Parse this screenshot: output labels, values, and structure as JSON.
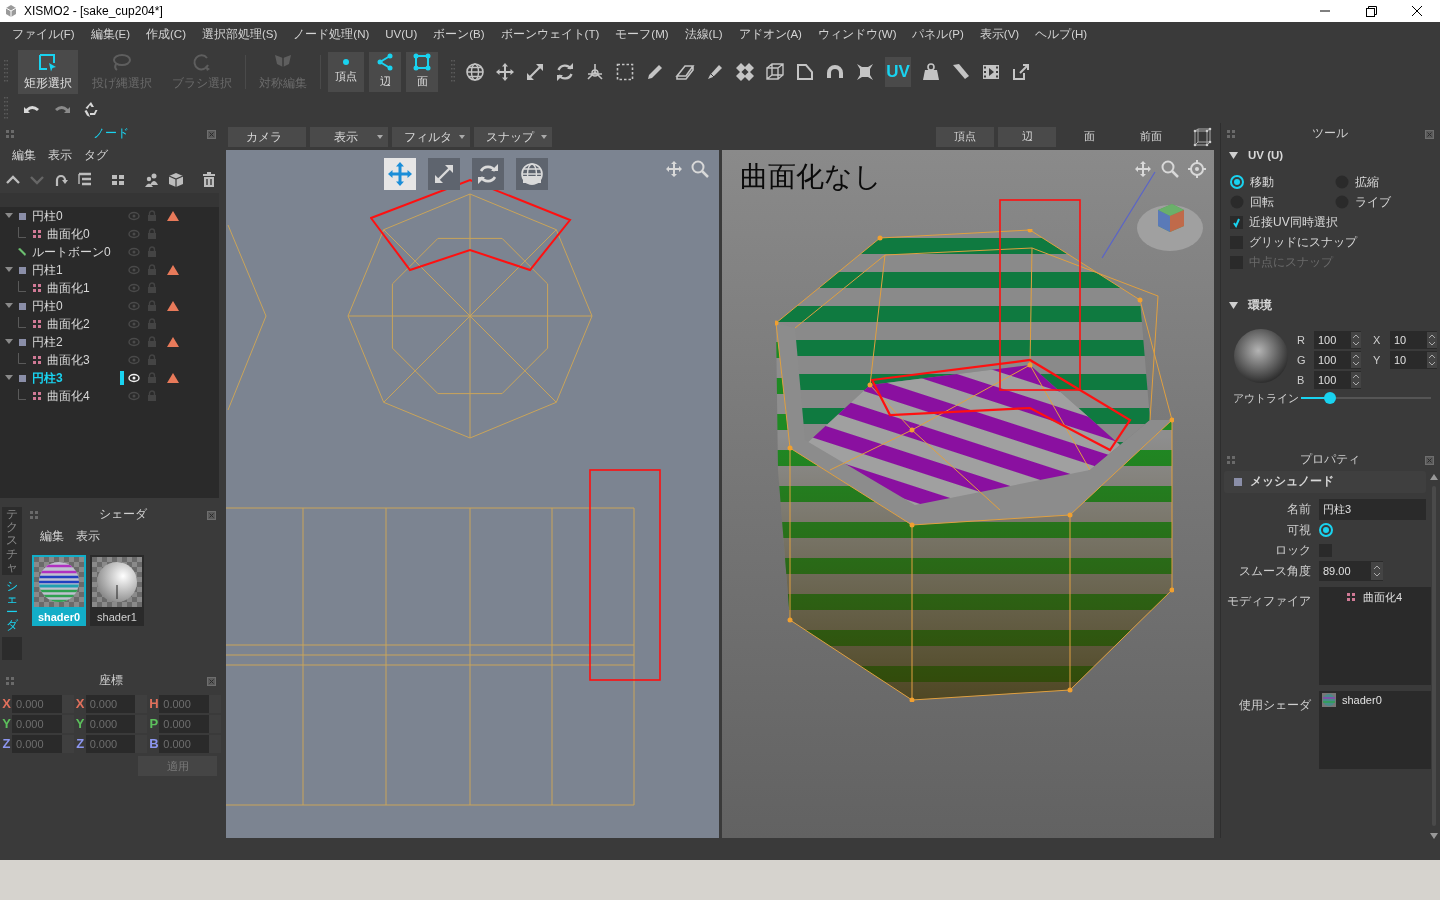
{
  "window": {
    "title": "XISMO2 - [sake_cup204*]"
  },
  "menu": [
    "ファイル(F)",
    "編集(E)",
    "作成(C)",
    "選択部処理(S)",
    "ノード処理(N)",
    "UV(U)",
    "ボーン(B)",
    "ボーンウェイト(T)",
    "モーフ(M)",
    "法線(L)",
    "アドオン(A)",
    "ウィンドウ(W)",
    "パネル(P)",
    "表示(V)",
    "ヘルプ(H)"
  ],
  "toolbar": {
    "select_tools": [
      {
        "label": "矩形選択",
        "selected": true,
        "disabled": false
      },
      {
        "label": "投げ縄選択",
        "selected": false,
        "disabled": true
      },
      {
        "label": "ブラシ選択",
        "selected": false,
        "disabled": true
      },
      {
        "label": "対称編集",
        "selected": false,
        "disabled": true
      }
    ],
    "modes": [
      {
        "label": "頂点",
        "selected": true
      },
      {
        "label": "辺",
        "selected": true
      },
      {
        "label": "面",
        "selected": true
      }
    ],
    "uv_button": {
      "label": "UV",
      "selected": true
    }
  },
  "node_panel": {
    "title": "ノード",
    "active": true,
    "menu": [
      "編集",
      "表示",
      "タグ"
    ],
    "tree": [
      {
        "label": "円柱0",
        "kind": "mesh",
        "expanded": true,
        "selected": false,
        "warning": true,
        "children": [
          {
            "label": "曲面化0",
            "kind": "modifier",
            "selected": false
          }
        ]
      },
      {
        "label": "ルートボーン0",
        "kind": "bone",
        "selected": false
      },
      {
        "label": "円柱1",
        "kind": "mesh",
        "expanded": true,
        "selected": false,
        "warning": true,
        "children": [
          {
            "label": "曲面化1",
            "kind": "modifier",
            "selected": false
          }
        ]
      },
      {
        "label": "円柱0",
        "kind": "mesh",
        "expanded": true,
        "selected": false,
        "warning": true,
        "children": [
          {
            "label": "曲面化2",
            "kind": "modifier",
            "selected": false
          }
        ]
      },
      {
        "label": "円柱2",
        "kind": "mesh",
        "expanded": true,
        "selected": false,
        "warning": true,
        "children": [
          {
            "label": "曲面化3",
            "kind": "modifier",
            "selected": false
          }
        ]
      },
      {
        "label": "円柱3",
        "kind": "mesh",
        "expanded": true,
        "selected": true,
        "warning": true,
        "children": [
          {
            "label": "曲面化4",
            "kind": "modifier",
            "selected": false
          }
        ]
      }
    ]
  },
  "shader_panel": {
    "title": "シェーダ",
    "active": false,
    "side_tabs": [
      {
        "label": "テクスチャ",
        "selected": false
      },
      {
        "label": "シェーダ",
        "selected": true
      }
    ],
    "menu": [
      "編集",
      "表示"
    ],
    "shaders": [
      {
        "name": "shader0",
        "kind": "striped",
        "selected": true
      },
      {
        "name": "shader1",
        "kind": "white",
        "selected": false
      }
    ]
  },
  "coords_panel": {
    "title": "座標",
    "active": false,
    "fields": [
      {
        "label": "X",
        "value": "0.000",
        "color": "#e0705c"
      },
      {
        "label": "X",
        "value": "0.000",
        "color": "#e0705c"
      },
      {
        "label": "H",
        "value": "0.000",
        "color": "#e0705c"
      },
      {
        "label": "Y",
        "value": "0.000",
        "color": "#5cc05c"
      },
      {
        "label": "Y",
        "value": "0.000",
        "color": "#5cc05c"
      },
      {
        "label": "P",
        "value": "0.000",
        "color": "#5cc05c"
      },
      {
        "label": "Z",
        "value": "0.000",
        "color": "#8c96f0"
      },
      {
        "label": "Z",
        "value": "0.000",
        "color": "#8c96f0"
      },
      {
        "label": "B",
        "value": "0.000",
        "color": "#8c96f0"
      }
    ],
    "apply_button": {
      "label": "適用",
      "disabled": true
    }
  },
  "viewport_bar": {
    "left": [
      {
        "label": "カメラ",
        "dropdown": false
      },
      {
        "label": "表示",
        "dropdown": true
      },
      {
        "label": "フィルタ",
        "dropdown": true
      },
      {
        "label": "スナップ",
        "dropdown": true
      }
    ],
    "right": [
      {
        "label": "頂点",
        "selected": true
      },
      {
        "label": "辺",
        "selected": true
      },
      {
        "label": "面",
        "selected": false
      },
      {
        "label": "前面",
        "selected": false
      }
    ]
  },
  "uv_view": {
    "tools": [
      {
        "kind": "move",
        "selected": true
      },
      {
        "kind": "scale",
        "selected": false
      },
      {
        "kind": "rotate",
        "selected": false
      },
      {
        "kind": "live",
        "selected": false
      }
    ]
  },
  "model_view": {
    "label": "曲面化なし"
  },
  "tool_panel": {
    "title": "ツール",
    "active": false,
    "uv_section": {
      "title": "UV (U)",
      "expanded": true,
      "radios": [
        {
          "label": "移動",
          "selected": true
        },
        {
          "label": "拡縮",
          "selected": false
        },
        {
          "label": "回転",
          "selected": false
        },
        {
          "label": "ライブ",
          "selected": false
        }
      ],
      "checkboxes": [
        {
          "label": "近接UV同時選択",
          "checked": true,
          "disabled": false
        },
        {
          "label": "グリッドにスナップ",
          "checked": false,
          "disabled": false
        },
        {
          "label": "中点にスナップ",
          "checked": false,
          "disabled": true
        }
      ]
    },
    "env_section": {
      "title": "環境",
      "expanded": true,
      "fields": [
        {
          "label": "R",
          "value": "100"
        },
        {
          "label": "G",
          "value": "100"
        },
        {
          "label": "B",
          "value": "100"
        },
        {
          "label": "X",
          "value": "10"
        },
        {
          "label": "Y",
          "value": "10"
        }
      ],
      "outline": {
        "label": "アウトライン",
        "level": 0.22
      }
    }
  },
  "properties_panel": {
    "title": "プロパティ",
    "active": false,
    "section": "メッシュノード",
    "name": {
      "label": "名前",
      "value": "円柱3"
    },
    "visible": {
      "label": "可視",
      "checked": true
    },
    "lock": {
      "label": "ロック",
      "checked": false
    },
    "smooth": {
      "label": "スムース角度",
      "value": "89.00"
    },
    "modifiers": {
      "label": "モディファイア",
      "items": [
        "曲面化4"
      ]
    },
    "shaders": {
      "label": "使用シェーダ",
      "items": [
        "shader0"
      ]
    }
  }
}
